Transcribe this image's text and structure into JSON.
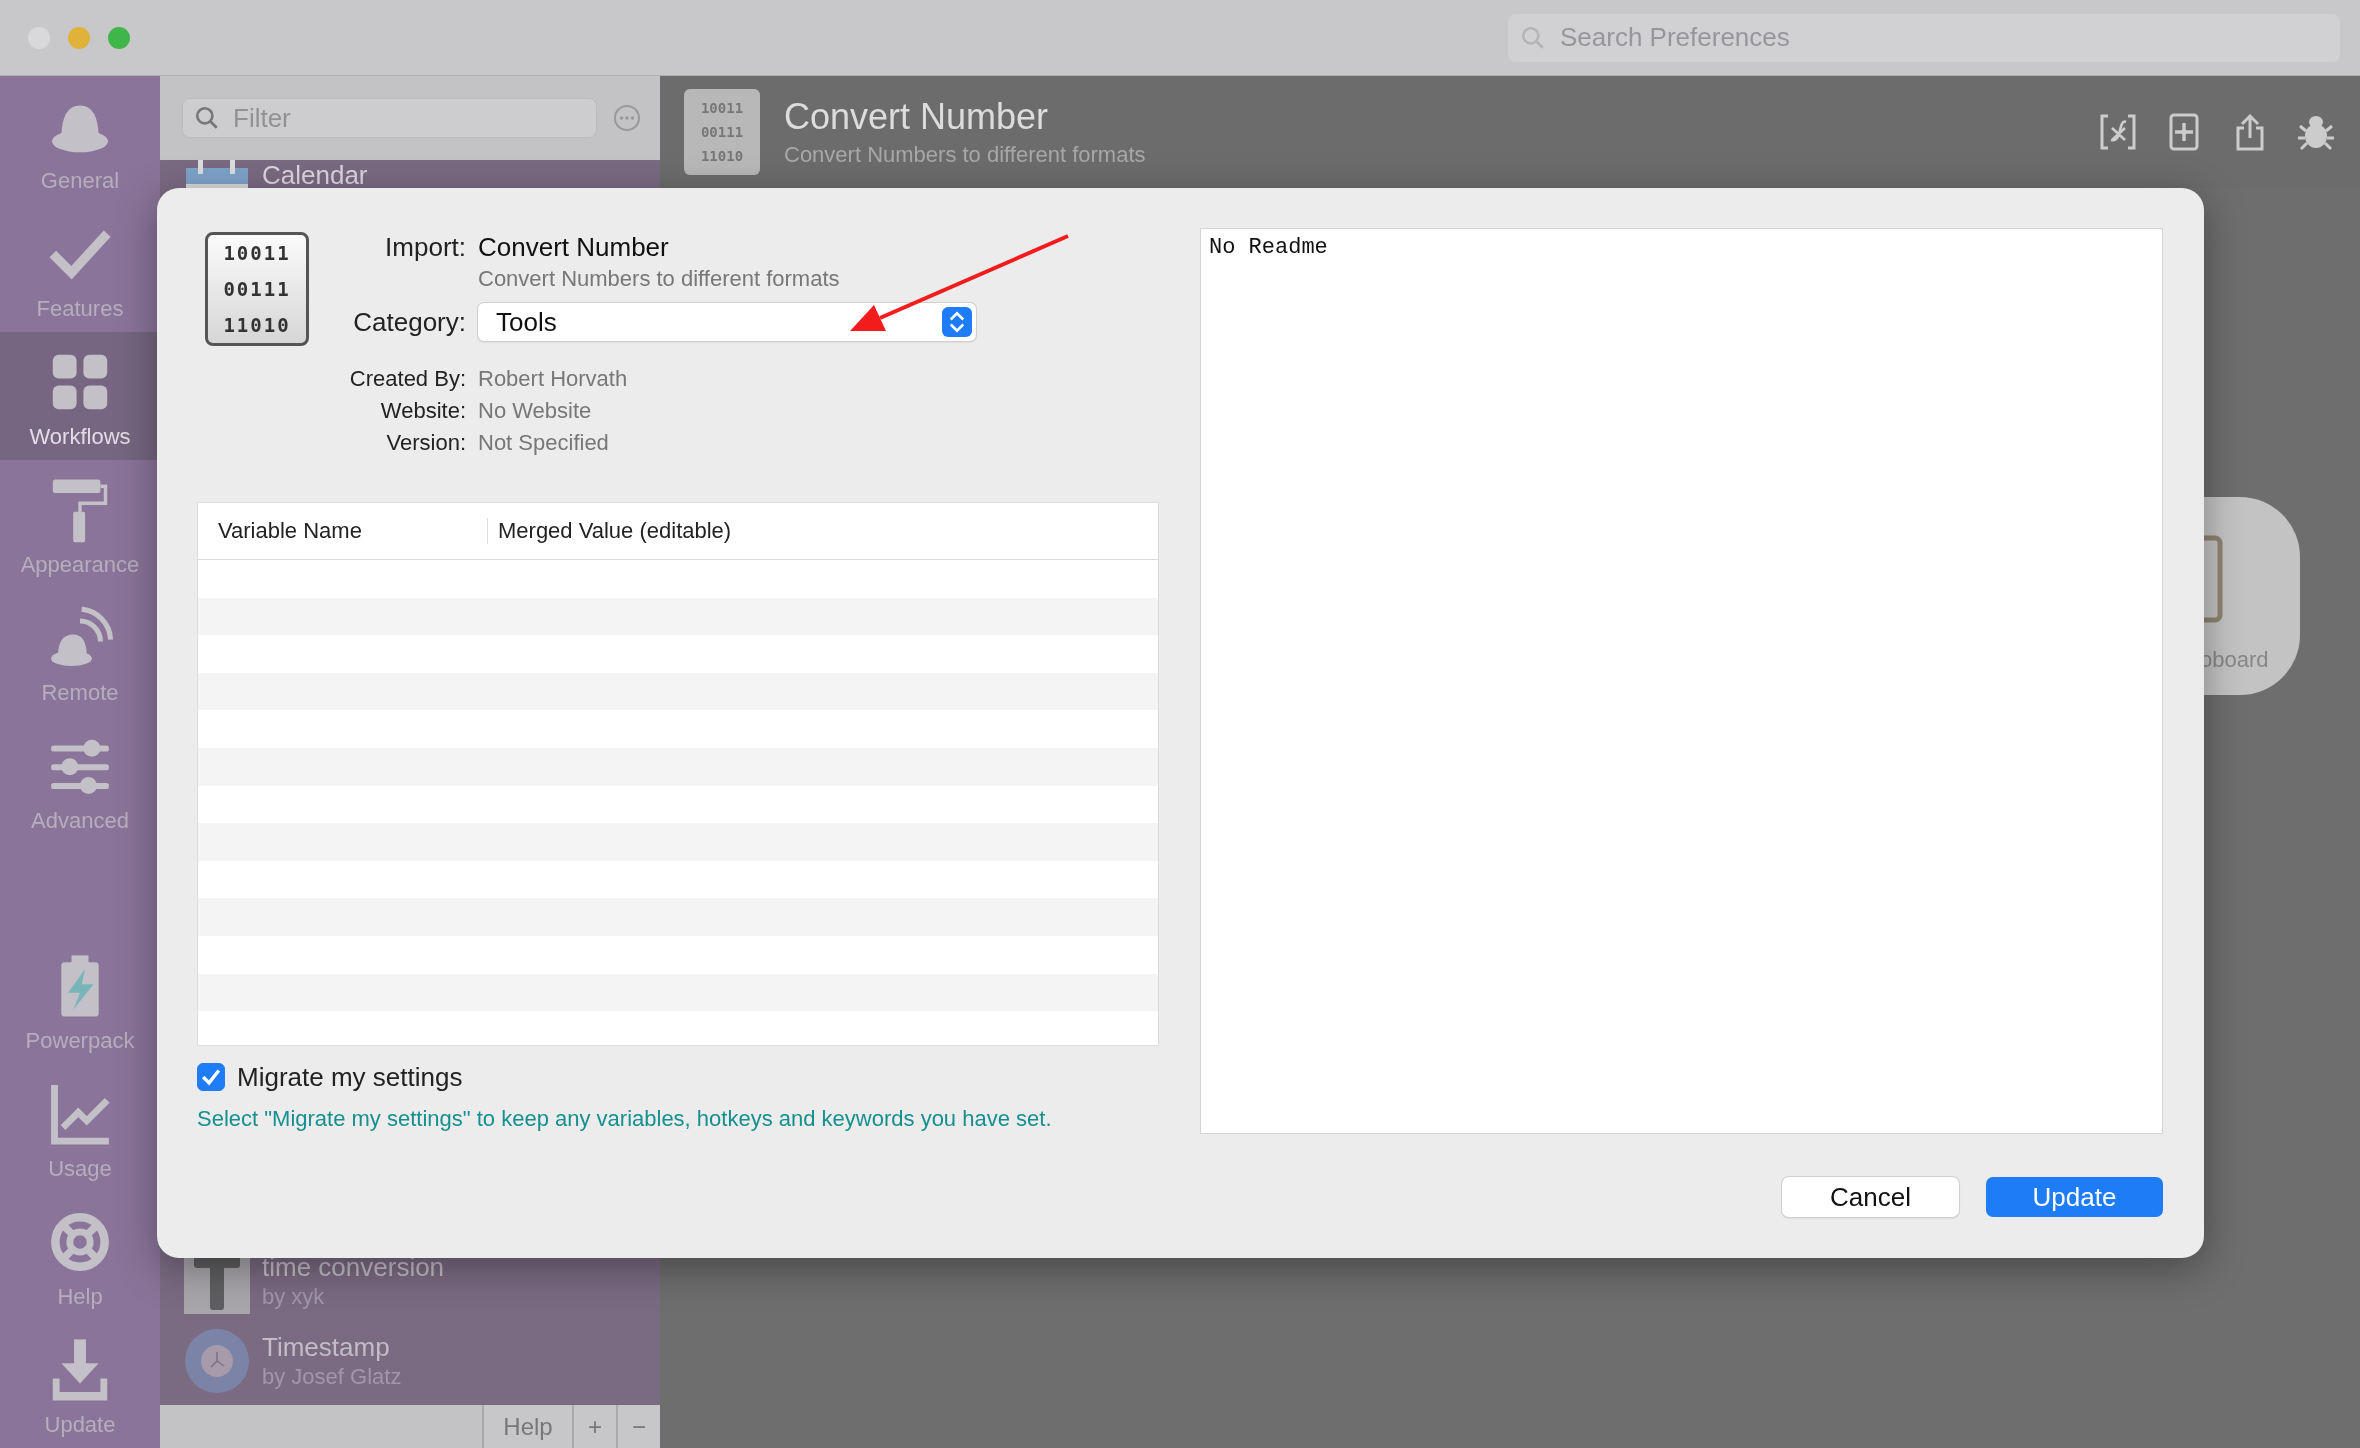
{
  "window": {
    "search": {
      "placeholder": "Search Preferences"
    }
  },
  "sidebar": {
    "items": [
      {
        "label": "General",
        "kind": "hat",
        "selected": false
      },
      {
        "label": "Features",
        "kind": "check",
        "selected": false
      },
      {
        "label": "Workflows",
        "kind": "grid",
        "selected": true
      },
      {
        "label": "Appearance",
        "kind": "roller",
        "selected": false
      },
      {
        "label": "Remote",
        "kind": "remote",
        "selected": false
      },
      {
        "label": "Advanced",
        "kind": "sliders",
        "selected": false
      },
      {
        "label": "Powerpack",
        "kind": "battery",
        "selected": false
      },
      {
        "label": "Usage",
        "kind": "chart",
        "selected": false
      },
      {
        "label": "Help",
        "kind": "lifebuoy",
        "selected": false
      },
      {
        "label": "Update",
        "kind": "download",
        "selected": false
      }
    ]
  },
  "workflow_list": {
    "filter": {
      "placeholder": "Filter"
    },
    "items": [
      {
        "title": "Calendar",
        "kind": "calendar"
      },
      {
        "title": "time conversion",
        "subtitle": "by xyk",
        "kind": "letter"
      },
      {
        "title": "Timestamp",
        "subtitle": "by Josef Glatz",
        "kind": "clock"
      }
    ],
    "footer_buttons": [
      "Help",
      "+",
      "−"
    ]
  },
  "header": {
    "icon_lines": [
      "10011",
      "00111",
      "11010"
    ],
    "title": "Convert Number",
    "subtitle": "Convert Numbers to different formats"
  },
  "clipboard_card": {
    "label": "oboard"
  },
  "dialog": {
    "icon_lines": [
      "10011",
      "00111",
      "11010"
    ],
    "import_label": "Import:",
    "name": "Convert Number",
    "description": "Convert Numbers to different formats",
    "category_label": "Category:",
    "category": "Tools",
    "details": [
      {
        "label": "Created By:",
        "value": "Robert Horvath"
      },
      {
        "label": "Website:",
        "value": "No Website"
      },
      {
        "label": "Version:",
        "value": "Not Specified"
      }
    ],
    "table": {
      "columns": [
        "Variable Name",
        "Merged Value (editable)"
      ]
    },
    "migrate": {
      "label": "Migrate my settings",
      "checked": true
    },
    "hint": "Select \"Migrate my settings\" to keep any variables, hotkeys and keywords you have set.",
    "readme": "No Readme",
    "buttons": [
      {
        "label": "Cancel",
        "kind": "secondary"
      },
      {
        "label": "Update",
        "kind": "primary"
      }
    ]
  }
}
